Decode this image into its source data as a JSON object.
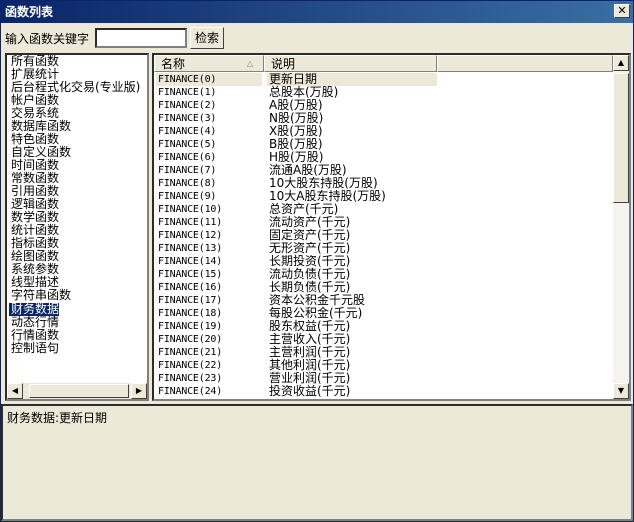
{
  "window": {
    "title": "函数列表",
    "close_glyph": "✕"
  },
  "search": {
    "label": "输入函数关键字",
    "value": "",
    "button_label": "检索"
  },
  "categories": [
    "所有函数",
    "扩展统计",
    "后台程式化交易(专业版)",
    "帐户函数",
    "交易系统",
    "数据库函数",
    "特色函数",
    "自定义函数",
    "时间函数",
    "常数函数",
    "引用函数",
    "逻辑函数",
    "数学函数",
    "统计函数",
    "指标函数",
    "绘图函数",
    "系统参数",
    "线型描述",
    "字符串函数",
    "财务数据",
    "动态行情",
    "行情函数",
    "控制语句"
  ],
  "selected_category": "财务数据",
  "table": {
    "headers": [
      "名称",
      "说明"
    ],
    "rows": [
      [
        "FINANCE(0)",
        "更新日期"
      ],
      [
        "FINANCE(1)",
        "总股本(万股)"
      ],
      [
        "FINANCE(2)",
        "A股(万股)"
      ],
      [
        "FINANCE(3)",
        "N股(万股)"
      ],
      [
        "FINANCE(4)",
        "X股(万股)"
      ],
      [
        "FINANCE(5)",
        "B股(万股)"
      ],
      [
        "FINANCE(6)",
        "H股(万股)"
      ],
      [
        "FINANCE(7)",
        "流通A股(万股)"
      ],
      [
        "FINANCE(8)",
        "10大股东持股(万股)"
      ],
      [
        "FINANCE(9)",
        "10大A股东持股(万股)"
      ],
      [
        "FINANCE(10)",
        "总资产(千元)"
      ],
      [
        "FINANCE(11)",
        "流动资产(千元)"
      ],
      [
        "FINANCE(12)",
        "固定资产(千元)"
      ],
      [
        "FINANCE(13)",
        "无形资产(千元)"
      ],
      [
        "FINANCE(14)",
        "长期投资(千元)"
      ],
      [
        "FINANCE(15)",
        "流动负债(千元)"
      ],
      [
        "FINANCE(16)",
        "长期负债(千元)"
      ],
      [
        "FINANCE(17)",
        "资本公积金千元股"
      ],
      [
        "FINANCE(18)",
        "每股公积金(千元)"
      ],
      [
        "FINANCE(19)",
        "股东权益(千元)"
      ],
      [
        "FINANCE(20)",
        "主营收入(千元)"
      ],
      [
        "FINANCE(21)",
        "主营利润(千元)"
      ],
      [
        "FINANCE(22)",
        "其他利润(千元)"
      ],
      [
        "FINANCE(23)",
        "营业利润(千元)"
      ],
      [
        "FINANCE(24)",
        "投资收益(千元)"
      ]
    ]
  },
  "description": "财务数据:更新日期"
}
